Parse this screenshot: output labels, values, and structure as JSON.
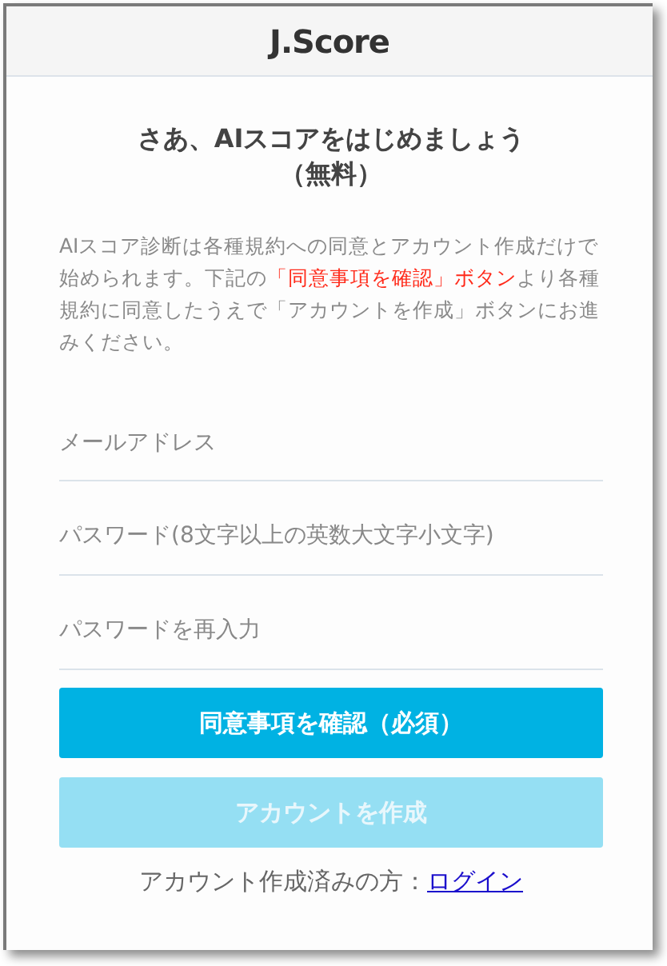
{
  "header": {
    "title": "J.Score"
  },
  "heading": {
    "line1": "さあ、AIスコアをはじめましょう",
    "line2": "（無料）"
  },
  "intro": [
    {
      "text": "AIスコア診断は各種規約への同意とアカウント作成だけで始められます。下記の",
      "highlight": false
    },
    {
      "text": "「同意事項を確認」ボタン",
      "highlight": true
    },
    {
      "text": "より各種規約に同意したうえで「アカウントを作成」ボタンにお進みください。",
      "highlight": false
    }
  ],
  "fields": [
    {
      "placeholder": "メールアドレス"
    },
    {
      "placeholder": "パスワード(8文字以上の英数大文字小文字)"
    },
    {
      "placeholder": "パスワードを再入力"
    }
  ],
  "buttons": [
    {
      "label": "同意事項を確認（必須）",
      "disabled": false
    },
    {
      "label": "アカウントを作成",
      "disabled": true
    }
  ],
  "login": {
    "text": "アカウント作成済みの方：",
    "link": "ログイン"
  }
}
